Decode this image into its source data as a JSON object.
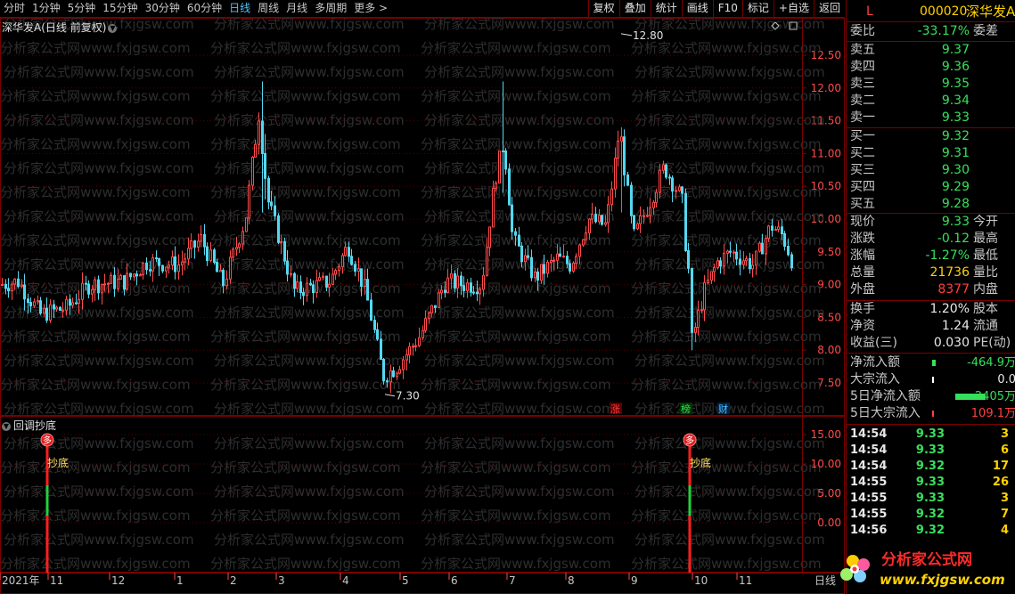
{
  "toolbar": {
    "periods": [
      "分时",
      "1分钟",
      "5分钟",
      "15分钟",
      "30分钟",
      "60分钟",
      "日线",
      "周线",
      "月线",
      "多周期",
      "更多 >"
    ],
    "active_period": "日线",
    "tools": [
      "复权",
      "叠加",
      "统计",
      "画线",
      "F10",
      "标记",
      "+自选",
      "返回"
    ]
  },
  "main_chart": {
    "title": "深华发A(日线 前复权)",
    "max_label": "12.80",
    "min_label": "7.30",
    "y_ticks": [
      "12.50",
      "12.00",
      "11.50",
      "11.00",
      "10.50",
      "10.00",
      "9.50",
      "9.00",
      "8.50",
      "8.00",
      "7.50"
    ],
    "markers": [
      "涨",
      "榜",
      "财"
    ],
    "watermark": "分析家公式网www.fxjgsw.com"
  },
  "indicator": {
    "title": "回调抄底",
    "y_ticks": [
      "15.00",
      "10.00",
      "5.00",
      "0.00"
    ],
    "signal_badge": "多",
    "signal_label": "抄底"
  },
  "x_axis": {
    "labels": [
      "2021年",
      "11",
      "12",
      "1",
      "2",
      "3",
      "4",
      "5",
      "6",
      "7",
      "8",
      "9",
      "10",
      "11"
    ],
    "unit": "日线"
  },
  "right_panel": {
    "header": {
      "flag": "L",
      "code": "000020",
      "name": "深华发A"
    },
    "weibi": {
      "label": "委比",
      "value": "-33.17%",
      "label2": "委差"
    },
    "sell": [
      {
        "label": "卖五",
        "price": "9.37"
      },
      {
        "label": "卖四",
        "price": "9.36"
      },
      {
        "label": "卖三",
        "price": "9.35"
      },
      {
        "label": "卖二",
        "price": "9.34"
      },
      {
        "label": "卖一",
        "price": "9.33"
      }
    ],
    "buy": [
      {
        "label": "买一",
        "price": "9.32"
      },
      {
        "label": "买二",
        "price": "9.31"
      },
      {
        "label": "买三",
        "price": "9.30"
      },
      {
        "label": "买四",
        "price": "9.29"
      },
      {
        "label": "买五",
        "price": "9.28"
      }
    ],
    "quote": [
      {
        "label": "现价",
        "value": "9.33",
        "label2": "今开"
      },
      {
        "label": "涨跌",
        "value": "-0.12",
        "label2": "最高"
      },
      {
        "label": "涨幅",
        "value": "-1.27%",
        "label2": "最低"
      },
      {
        "label": "总量",
        "value": "21736",
        "label2": "量比"
      },
      {
        "label": "外盘",
        "value": "8377",
        "label2": "内盘"
      }
    ],
    "fund": [
      {
        "label": "换手",
        "value": "1.20%",
        "label2": "股本"
      },
      {
        "label": "净资",
        "value": "1.24",
        "label2": "流通"
      },
      {
        "label": "收益(三)",
        "value": "0.030",
        "label2": "PE(动)"
      }
    ],
    "flows": [
      {
        "label": "净流入额",
        "value": "-464.9万"
      },
      {
        "label": "大宗流入",
        "value": "0.0"
      },
      {
        "label": "5日净流入额",
        "value": "-2405万"
      },
      {
        "label": "5日大宗流入",
        "value": "109.1万"
      }
    ],
    "ticks": [
      {
        "time": "14:54",
        "price": "9.33",
        "vol": "3"
      },
      {
        "time": "14:54",
        "price": "9.33",
        "vol": "6"
      },
      {
        "time": "14:54",
        "price": "9.32",
        "vol": "17"
      },
      {
        "time": "14:55",
        "price": "9.33",
        "vol": "26"
      },
      {
        "time": "14:55",
        "price": "9.33",
        "vol": "3"
      },
      {
        "time": "14:55",
        "price": "9.32",
        "vol": "7"
      },
      {
        "time": "14:56",
        "price": "9.32",
        "vol": "4"
      }
    ]
  },
  "logo": {
    "text": "分析家公式网",
    "url": "www.fxjgsw.com"
  },
  "colors": {
    "up": "#ff4a4a",
    "down": "#54d8f0",
    "border": "#7a0000",
    "active": "#4fc3ff",
    "green": "#36e05a"
  }
}
